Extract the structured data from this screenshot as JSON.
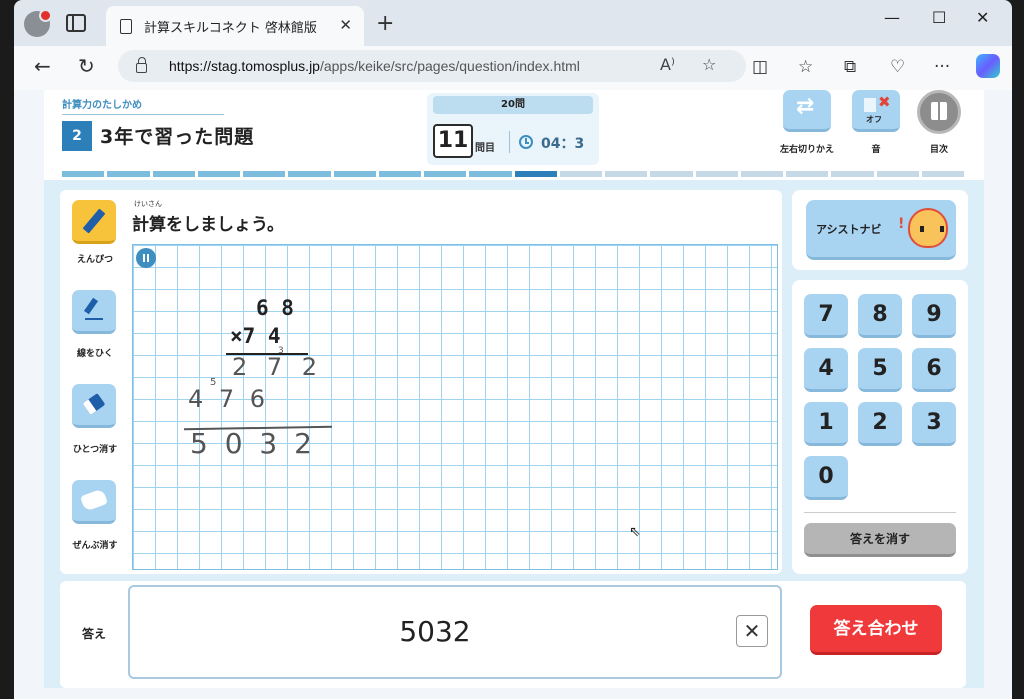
{
  "browser": {
    "tab_title": "計算スキルコネクト 啓林館版",
    "tab_close": "✕",
    "new_tab": "+",
    "url_host": "https://stag.tomosplus.jp",
    "url_path": "/apps/keike/src/pages/question/index.html",
    "win_min": "—",
    "win_max": "☐",
    "win_close": "✕",
    "back": "←",
    "reload": "↻",
    "read_aloud": "A⁾",
    "favorite": "☆",
    "split": "◫",
    "favorites": "☆",
    "collections": "⧉",
    "performance": "♡",
    "more": "···"
  },
  "header": {
    "subtitle": "計算力のたしかめ",
    "badge": "2",
    "title": "3年で習った問題",
    "question_total": "20問",
    "question_number": "11",
    "question_unit": "問目",
    "timer": "04：3",
    "swap_label": "左右切りかえ",
    "sound_label": "音",
    "sound_state": "オフ",
    "contents_label": "目次"
  },
  "progress": {
    "total": 20,
    "done": 10,
    "current": 11
  },
  "tools": {
    "pen": "えんぴつ",
    "line": "線をひく",
    "erase_one": "ひとつ消す",
    "erase_all": "ぜんぶ消す"
  },
  "work": {
    "prompt_ruby": "けいさん",
    "prompt": "計算をしましょう。",
    "multiplicand": "6 8",
    "multiplier": "×7 4",
    "hand_row1": "2 7 2",
    "hand_carry1": "3",
    "hand_row2": "4 7 6",
    "hand_carry2": "5",
    "hand_result": "5 0 3 2"
  },
  "assist": {
    "label": "アシストナビ"
  },
  "keypad": {
    "keys": [
      "7",
      "8",
      "9",
      "4",
      "5",
      "6",
      "1",
      "2",
      "3",
      "0"
    ],
    "clear": "答えを消す"
  },
  "answer": {
    "label": "答え",
    "value": "5032",
    "clear_x": "✕",
    "check": "答え合わせ"
  }
}
